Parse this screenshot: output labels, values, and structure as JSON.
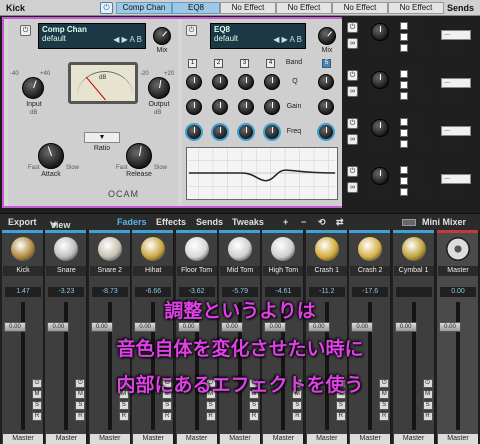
{
  "topbar": {
    "track": "Kick",
    "power": "⏻",
    "slots": [
      "Comp Chan",
      "EQ8",
      "No Effect",
      "No Effect",
      "No Effect",
      "No Effect"
    ],
    "sends": "Sends"
  },
  "comp": {
    "name": "Comp Chan",
    "preset": "default",
    "ab": "A B",
    "arrows": "◀ ▶",
    "mix": "Mix",
    "input": "Input",
    "output": "Output",
    "db": "dB",
    "ratio": "Ratio",
    "ratio_arrow": "▼",
    "attack": "Attack",
    "release": "Release",
    "fast": "Fast",
    "slow": "Slow",
    "meter": "dB",
    "scale": {
      "in_min": "-40",
      "in_max": "+40",
      "out_min": "-20",
      "out_max": "+20"
    },
    "brand": "OCAM"
  },
  "eq": {
    "name": "EQ8",
    "preset": "default",
    "ab": "A B",
    "mix": "Mix",
    "band": "Band",
    "q": "Q",
    "gain": "Gain",
    "freq": "Freq",
    "bands": [
      "1",
      "2",
      "3",
      "4",
      "5"
    ]
  },
  "sends": {
    "rows": [
      {
        "level": "Level",
        "pre": "Pre",
        "fx": "FX",
        "fader": "Fader",
        "dest": "Dest",
        "dd": "---"
      },
      {
        "level": "Level",
        "pre": "Pre",
        "fx": "FX",
        "fader": "Fader",
        "dest": "Dest",
        "dd": "---"
      },
      {
        "level": "Level",
        "pre": "Pre",
        "fx": "FX",
        "fader": "Fader",
        "dest": "Dest",
        "dd": "---"
      },
      {
        "level": "Level",
        "pre": "Pre",
        "fx": "FX",
        "fader": "Fader",
        "dest": "Dest",
        "dd": "---"
      }
    ]
  },
  "mixbar": {
    "export": "Export",
    "view": "View",
    "view_arrow": "▼",
    "faders": "Faders",
    "effects": "Effects",
    "sends": "Sends",
    "tweaks": "Tweaks",
    "plus": "+",
    "minus": "−",
    "cycle": "⟲",
    "link": "⇄",
    "mini": "Mini Mixer"
  },
  "strips": [
    {
      "name": "Kick",
      "val": "1.47",
      "fader": "0.00",
      "color": "#b08a40",
      "out": "Master"
    },
    {
      "name": "Snare",
      "val": "-3.23",
      "fader": "0.00",
      "color": "#bfbfbf",
      "out": "Master"
    },
    {
      "name": "Snare 2",
      "val": "-8.73",
      "fader": "0.00",
      "color": "#c8c0b0",
      "out": "Master"
    },
    {
      "name": "Hihat",
      "val": "-6.66",
      "fader": "0.00",
      "color": "#c9a640",
      "out": "Master"
    },
    {
      "name": "Floor Tom",
      "val": "-3.62",
      "fader": "0.00",
      "color": "#d8d8d8",
      "out": "Master"
    },
    {
      "name": "Mid Tom",
      "val": "-5.79",
      "fader": "0.00",
      "color": "#d0d0d0",
      "out": "Master"
    },
    {
      "name": "High Tom",
      "val": "-4.61",
      "fader": "0.00",
      "color": "#cfcfcf",
      "out": "Master"
    },
    {
      "name": "Crash 1",
      "val": "-11.2",
      "fader": "0.00",
      "color": "#d4aa3a",
      "out": "Master"
    },
    {
      "name": "Crash 2",
      "val": "-17.6",
      "fader": "0.00",
      "color": "#d6b04a",
      "out": "Master"
    },
    {
      "name": "Cymbal 1",
      "val": "",
      "fader": "0.00",
      "color": "#c0a238",
      "out": "Master"
    }
  ],
  "master": {
    "name": "Master",
    "val": "0.00",
    "fader": "0.00",
    "out": "Master"
  },
  "strip_buttons": [
    "⏻",
    "M",
    "S",
    "R"
  ],
  "overlay": [
    "調整というよりは",
    "音色自体を変化させたい時に",
    "内部にあるエフェクトを使う"
  ]
}
